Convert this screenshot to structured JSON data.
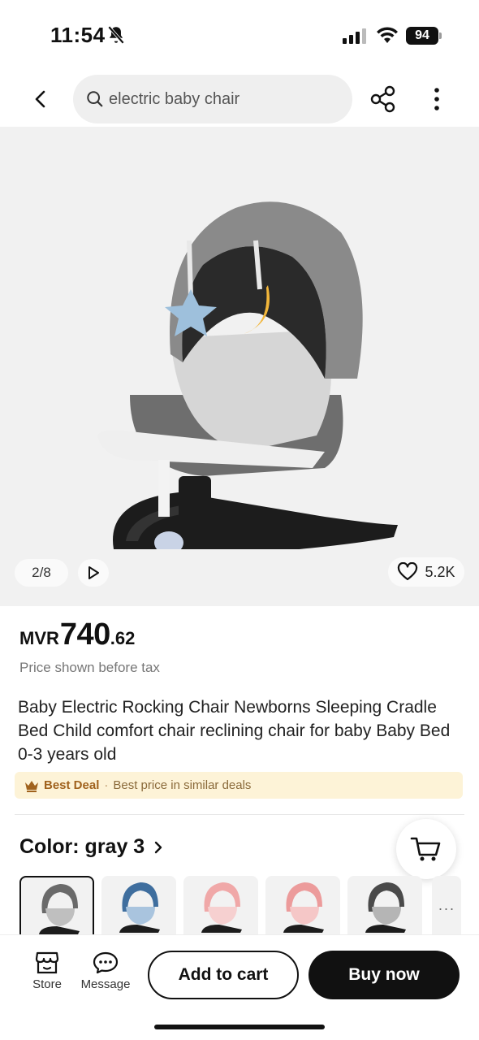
{
  "status_bar": {
    "time": "11:54",
    "battery": "94",
    "icons": [
      "bell-off-icon",
      "signal-icon",
      "wifi-icon",
      "battery-icon"
    ]
  },
  "header": {
    "search_value": "electric baby chair",
    "icons": [
      "back-arrow-icon",
      "search-icon",
      "share-icon",
      "more-vertical-icon"
    ]
  },
  "gallery": {
    "page_indicator": "2/8",
    "likes": "5.2K",
    "icons": [
      "play-icon",
      "heart-icon"
    ]
  },
  "product": {
    "currency": "MVR",
    "price_main": "740",
    "price_decimal": ".62",
    "tax_note": "Price shown before tax",
    "title": "Baby Electric Rocking Chair Newborns Sleeping Cradle Bed Child comfort chair reclining chair for baby Baby Bed 0-3 years old",
    "best_deal": {
      "label": "Best Deal",
      "separator": "·",
      "text": "Best price in similar deals"
    }
  },
  "color": {
    "label": "Color: gray 3",
    "swatches": [
      {
        "name": "gray",
        "canopy": "#6a6a6a",
        "seat": "#bfbfbf",
        "selected": true
      },
      {
        "name": "blue",
        "canopy": "#3f6e9e",
        "seat": "#a9c4de",
        "selected": false
      },
      {
        "name": "pink",
        "canopy": "#f0a8a8",
        "seat": "#f6d0d0",
        "selected": false
      },
      {
        "name": "pink-2",
        "canopy": "#ec9b9b",
        "seat": "#f5c7c7",
        "selected": false
      },
      {
        "name": "dark-gray",
        "canopy": "#4a4a4a",
        "seat": "#b5b5b5",
        "selected": false
      }
    ],
    "more": "···"
  },
  "bottom_bar": {
    "store_label": "Store",
    "message_label": "Message",
    "add_to_cart": "Add to cart",
    "buy_now": "Buy now"
  },
  "colors": {
    "accent": "#111111",
    "deal_bg": "#fdf3d7",
    "deal_text": "#a0621d"
  }
}
